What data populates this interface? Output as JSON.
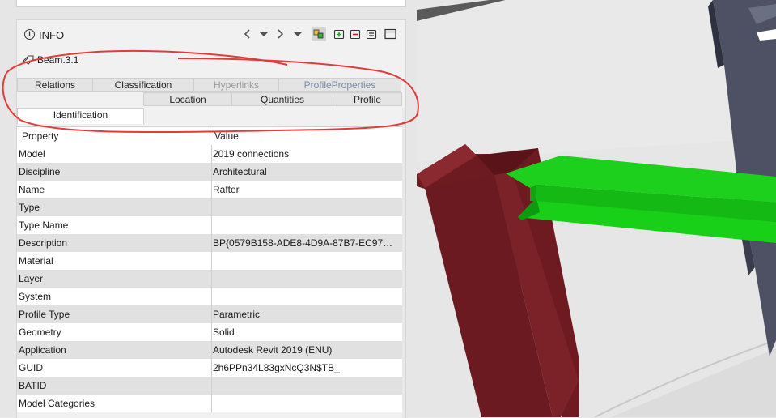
{
  "panel": {
    "title": "INFO",
    "element_name": "Beam.3.1",
    "tabs_back": [
      {
        "label": "Relations",
        "state": "normal"
      },
      {
        "label": "Classification",
        "state": "normal"
      },
      {
        "label": "Hyperlinks",
        "state": "disabled"
      },
      {
        "label": "ProfileProperties",
        "state": "dim"
      }
    ],
    "tabs_front": [
      {
        "label": "Identification",
        "state": "active"
      },
      {
        "label": "Location",
        "state": "normal"
      },
      {
        "label": "Quantities",
        "state": "normal"
      },
      {
        "label": "Profile",
        "state": "normal"
      }
    ],
    "table": {
      "headers": [
        "Property",
        "Value"
      ],
      "rows": [
        {
          "property": "Model",
          "value": "2019 connections"
        },
        {
          "property": "Discipline",
          "value": "Architectural"
        },
        {
          "property": "Name",
          "value": "Rafter"
        },
        {
          "property": "Type",
          "value": ""
        },
        {
          "property": "Type Name",
          "value": ""
        },
        {
          "property": "Description",
          "value": "BP{0579B158-ADE8-4D9A-87B7-EC97D222..."
        },
        {
          "property": "Material",
          "value": ""
        },
        {
          "property": "Layer",
          "value": ""
        },
        {
          "property": "System",
          "value": ""
        },
        {
          "property": "Profile Type",
          "value": "Parametric"
        },
        {
          "property": "Geometry",
          "value": "Solid"
        },
        {
          "property": "Application",
          "value": "Autodesk Revit 2019 (ENU)"
        },
        {
          "property": "GUID",
          "value": "2h6PPn34L83gxNcQ3N$TB_"
        },
        {
          "property": "BATID",
          "value": ""
        },
        {
          "property": "Model Categories",
          "value": ""
        }
      ]
    },
    "header_icons": [
      "chevron-left-icon",
      "caret-down-icon",
      "chevron-right-icon",
      "caret-down-icon",
      "cubes-icon",
      "add-icon",
      "remove-icon",
      "list-icon",
      "window-icon"
    ]
  },
  "colors": {
    "annotation": "#e53a3a",
    "beam_red": "#6e1c22",
    "beam_green": "#19d219",
    "column_dark": "#4a4e5e"
  }
}
